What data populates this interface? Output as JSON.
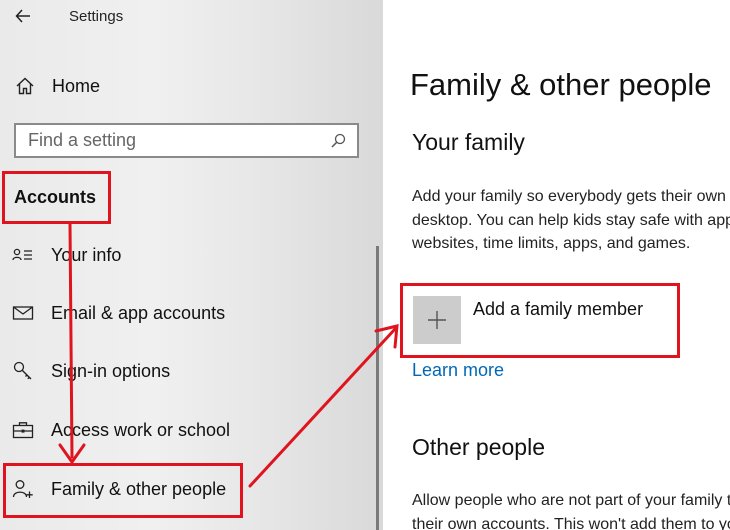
{
  "window": {
    "title": "Settings"
  },
  "sidebar": {
    "home_label": "Home",
    "search": {
      "placeholder": "Find a setting"
    },
    "section_title": "Accounts",
    "items": [
      {
        "label": "Your info",
        "icon": "person-card-icon"
      },
      {
        "label": "Email & app accounts",
        "icon": "mail-icon"
      },
      {
        "label": "Sign-in options",
        "icon": "key-icon"
      },
      {
        "label": "Access work or school",
        "icon": "briefcase-icon"
      },
      {
        "label": "Family & other people",
        "icon": "person-add-icon"
      }
    ]
  },
  "content": {
    "page_title": "Family & other people",
    "your_family": {
      "heading": "Your family",
      "description_lines": [
        "Add your family so everybody gets their own sign-in and",
        "desktop. You can help kids stay safe with appropriate",
        "websites, time limits, apps, and games."
      ],
      "add_button_label": "Add a family member",
      "learn_more_label": "Learn more"
    },
    "other_people": {
      "heading": "Other people",
      "description_lines": [
        "Allow people who are not part of your family to sign in with",
        "their own accounts. This won't add them to your family."
      ]
    }
  },
  "annotation": {
    "color": "#e0141e"
  }
}
